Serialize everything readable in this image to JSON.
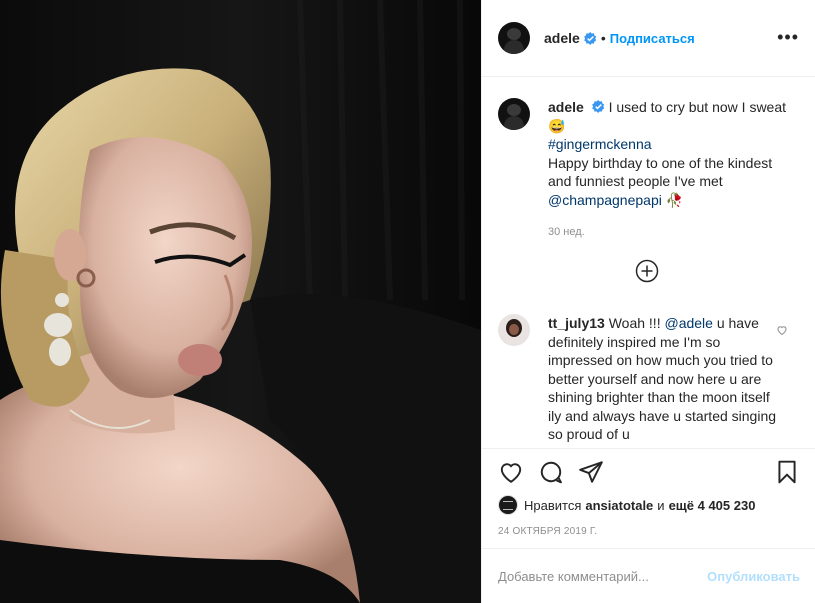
{
  "header": {
    "username": "adele",
    "follow_label": "Подписаться",
    "separator": "•",
    "more_label": "•••"
  },
  "caption": {
    "username": "adele",
    "text_line1": "I used to cry but now I sweat",
    "emoji": "😅",
    "hashtag": "#gingermckenna",
    "text_line2": "Happy birthday to one of the kindest and funniest people I've met",
    "mention": "@champagnepapi",
    "emoji2": "🥀",
    "time": "30 нед."
  },
  "comment": {
    "username": "tt_july13",
    "text_before": "Woah !!! ",
    "mention": "@adele",
    "text_after": " u have definitely inspired me I'm so impressed on how much you tried to better yourself and now here u are shining brighter than the moon itself ily and always have u started singing so proud of u"
  },
  "likes": {
    "prefix": "Нравится",
    "user": "ansiatotale",
    "middle": "и",
    "others": "ещё 4 405 230"
  },
  "date": "24 ОКТЯБРЯ 2019 Г.",
  "add_comment": {
    "placeholder": "Добавьте комментарий...",
    "publish_label": "Опубликовать"
  },
  "colors": {
    "accent": "#0095f6",
    "publish_disabled": "#b2dffc",
    "muted": "#8e8e8e",
    "mention": "#00376b"
  },
  "icons": [
    "verified-icon",
    "more-icon",
    "load-more-icon",
    "heart-icon",
    "comment-icon",
    "share-icon",
    "bookmark-icon"
  ]
}
